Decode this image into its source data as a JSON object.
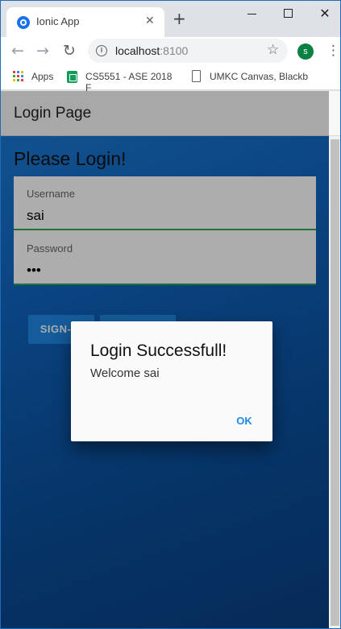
{
  "browser": {
    "tab_title": "Ionic App",
    "tab_close": "✕",
    "new_tab": "+",
    "window_close": "✕",
    "url_host": "localhost",
    "url_port": ":8100",
    "profile_initial": "s",
    "icons": {
      "back": "←",
      "forward": "→",
      "reload": "↻",
      "bookmark_star": "☆",
      "menu": "⋮",
      "info": "i"
    },
    "bookmarks": [
      {
        "label": "Apps"
      },
      {
        "label": "CS5551 - ASE 2018 F"
      },
      {
        "label": "UMKC Canvas, Blackb"
      }
    ]
  },
  "app": {
    "header_title": "Login Page",
    "page_heading": "Please Login!",
    "form": {
      "username_label": "Username",
      "username_value": "sai",
      "password_label": "Password",
      "password_value": "•••"
    },
    "buttons": {
      "signin": "SIGN-IN",
      "signup": "SIGN-UP"
    },
    "dialog": {
      "title": "Login Successfull!",
      "message": "Welcome sai",
      "ok": "OK"
    }
  },
  "colors": {
    "accent": "#1e88e5",
    "field_underline": "#32a852",
    "profile_avatar": "#0b8043"
  }
}
